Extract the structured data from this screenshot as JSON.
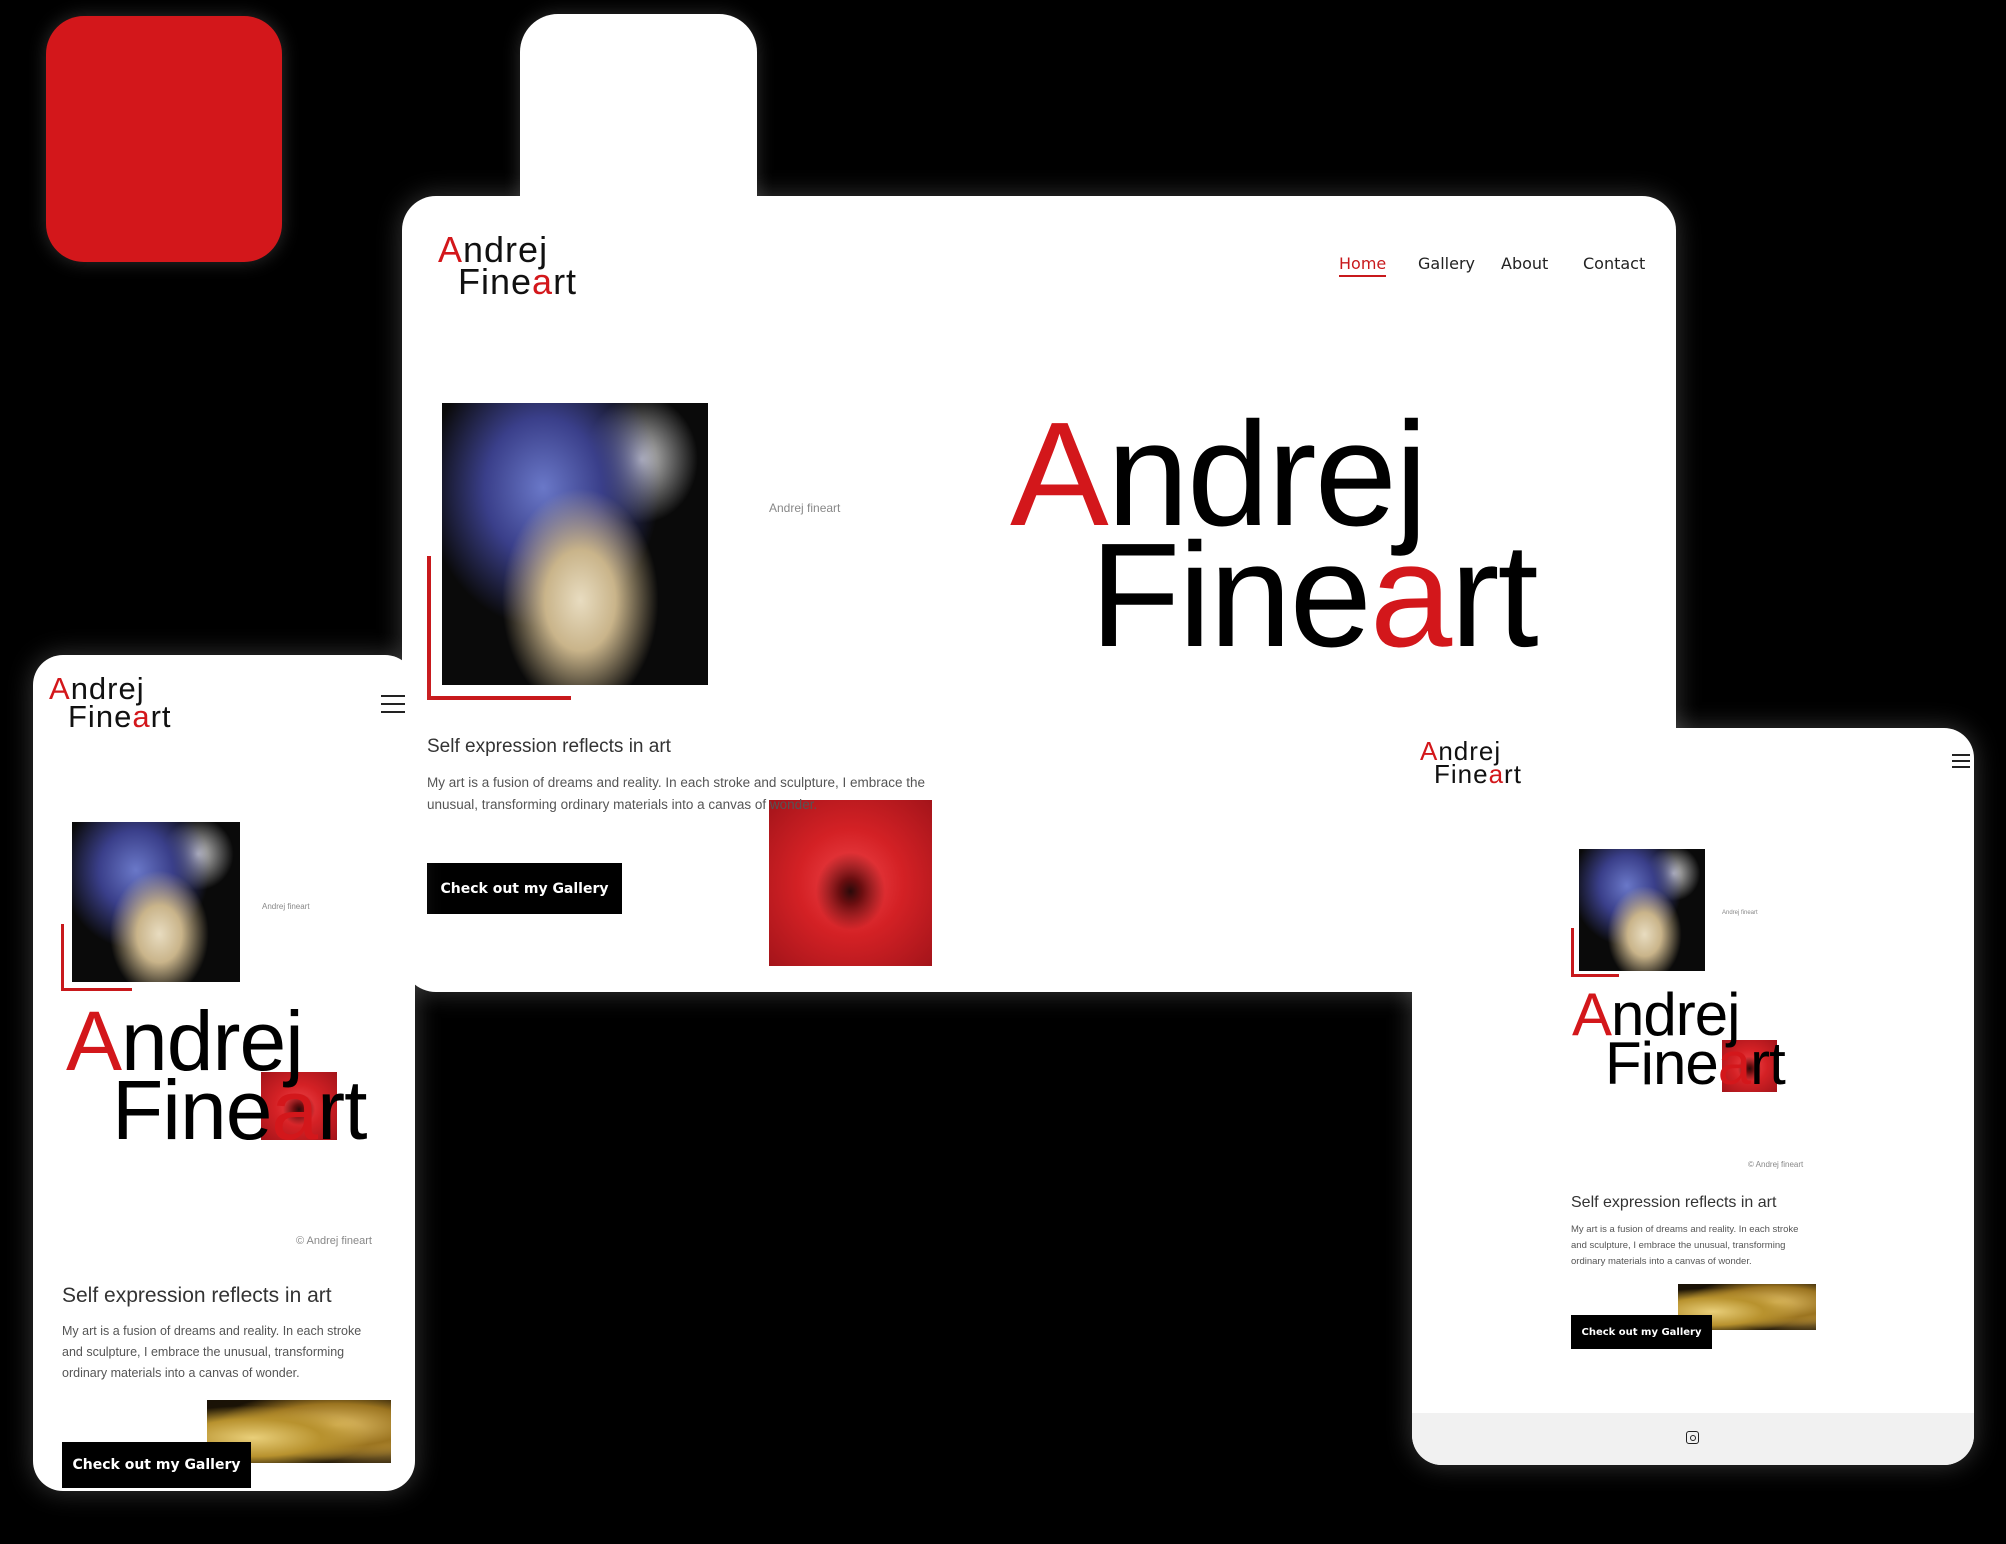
{
  "swatches": {
    "primary": "#d3171b",
    "secondary": "#ffffff"
  },
  "brand": {
    "first_accent": "A",
    "first_rest": "ndrej",
    "second_pre": "Fine",
    "second_accent": "a",
    "second_post": "rt",
    "accent_color": "#d3171b"
  },
  "nav": {
    "items": [
      "Home",
      "Gallery",
      "About",
      "Contact"
    ],
    "active": "Home"
  },
  "hero": {
    "art_caption": "Andrej fineart",
    "copyright": "© Andrej fineart",
    "heading": "Self expression reflects in art",
    "body": "My art is a fusion of dreams and reality. In each stroke and sculpture, I embrace the unusual, transforming ordinary materials into a canvas of wonder.",
    "cta": "Check out my Gallery"
  },
  "icons": {
    "menu": "hamburger-menu-icon",
    "social": "instagram-icon"
  }
}
